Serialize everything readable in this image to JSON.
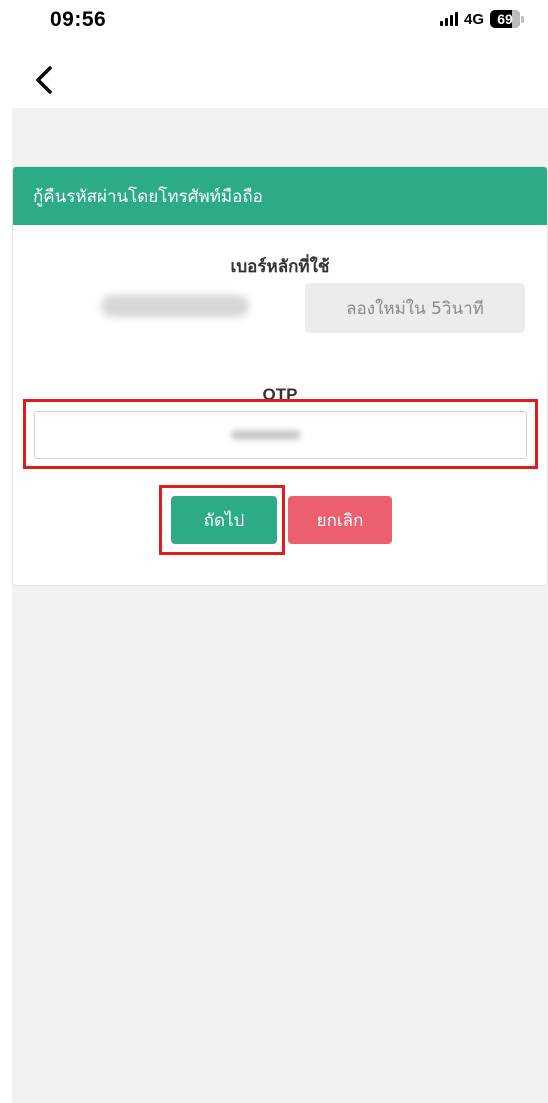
{
  "status_bar": {
    "time": "09:56",
    "network": "4G",
    "battery": "69"
  },
  "nav": {
    "back_icon": "chevron-left-icon"
  },
  "card": {
    "title": "กู้คืนรหัสผ่านโดยโทรศัพท์มือถือ",
    "phone_label": "เบอร์หลักที่ใช้",
    "retry_label": "ลองใหม่ใน 5วินาที",
    "otp_label": "OTP",
    "next_label": "ถัดไป",
    "cancel_label": "ยกเลิก"
  },
  "colors": {
    "primary_green": "#2bab86",
    "cancel_red": "#ec5f6f",
    "highlight_red": "#e21b1b"
  }
}
